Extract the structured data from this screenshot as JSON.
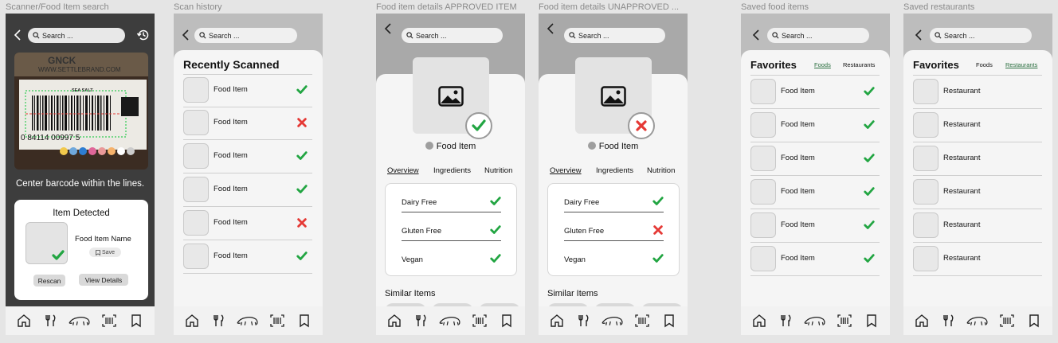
{
  "frames": [
    {
      "label": "Scanner/Food Item search"
    },
    {
      "label": "Scan history"
    },
    {
      "label": "Food item details APPROVED ITEM"
    },
    {
      "label": "Food item details UNAPPROVED ..."
    },
    {
      "label": "Saved food items"
    },
    {
      "label": "Saved restaurants"
    }
  ],
  "search_placeholder": "Search ...",
  "scanner": {
    "barcode_brand": "WWW.SETTLEBRAND.COM",
    "barcode_number": "0 84114 00997 5",
    "label_text": "SEA SALT",
    "hint": "Center barcode within the lines.",
    "detected_title": "Item Detected",
    "item_name": "Food Item Name",
    "save_label": "Save",
    "rescan_label": "Rescan",
    "view_details_label": "View Details"
  },
  "history": {
    "title": "Recently Scanned",
    "items": [
      {
        "label": "Food Item",
        "status": "approved"
      },
      {
        "label": "Food Item",
        "status": "rejected"
      },
      {
        "label": "Food Item",
        "status": "approved"
      },
      {
        "label": "Food Item",
        "status": "approved"
      },
      {
        "label": "Food Item",
        "status": "rejected"
      },
      {
        "label": "Food Item",
        "status": "approved"
      }
    ]
  },
  "details": {
    "name": "Food Item",
    "tabs": [
      "Overview",
      "Ingredients",
      "Nutrition"
    ],
    "similar_title": "Similar Items",
    "approved_attrs": [
      {
        "label": "Dairy Free",
        "status": "approved"
      },
      {
        "label": "Gluten Free",
        "status": "approved"
      },
      {
        "label": "Vegan",
        "status": "approved"
      }
    ],
    "unapproved_attrs": [
      {
        "label": "Dairy Free",
        "status": "approved"
      },
      {
        "label": "Gluten Free",
        "status": "rejected"
      },
      {
        "label": "Vegan",
        "status": "approved"
      }
    ]
  },
  "favorites": {
    "title": "Favorites",
    "tab_foods": "Foods",
    "tab_restaurants": "Restaurants",
    "foods": [
      {
        "label": "Food Item",
        "status": "approved"
      },
      {
        "label": "Food Item",
        "status": "approved"
      },
      {
        "label": "Food Item",
        "status": "approved"
      },
      {
        "label": "Food Item",
        "status": "approved"
      },
      {
        "label": "Food Item",
        "status": "approved"
      },
      {
        "label": "Food Item",
        "status": "approved"
      }
    ],
    "restaurants": [
      {
        "label": "Restaurant"
      },
      {
        "label": "Restaurant"
      },
      {
        "label": "Restaurant"
      },
      {
        "label": "Restaurant"
      },
      {
        "label": "Restaurant"
      },
      {
        "label": "Restaurant"
      }
    ]
  },
  "nav": [
    {
      "icon": "home-icon"
    },
    {
      "icon": "restaurant-icon"
    },
    {
      "icon": "anteater-icon"
    },
    {
      "icon": "barcode-scan-icon"
    },
    {
      "icon": "bookmark-icon"
    }
  ],
  "colors": {
    "approved": "#22a542",
    "rejected": "#e53935",
    "link": "#2a6e3f"
  }
}
